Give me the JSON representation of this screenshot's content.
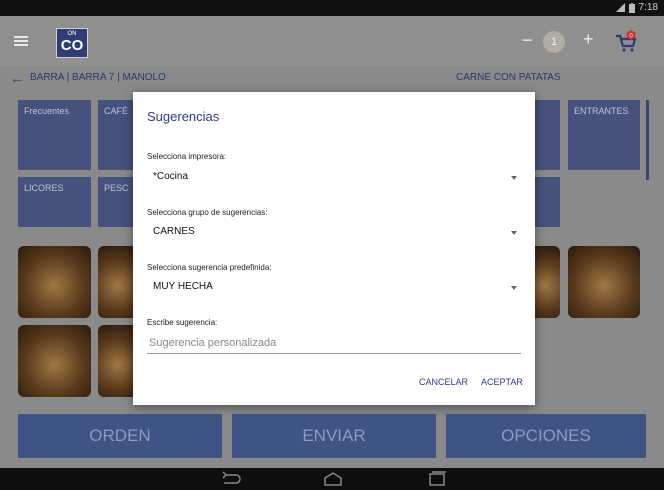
{
  "status_bar": {
    "time": "7:18"
  },
  "app_bar": {
    "logo_top": "ON",
    "logo_main": "CO",
    "qty_minus": "−",
    "qty_value": "1",
    "qty_plus": "+",
    "cart_badge": "0"
  },
  "breadcrumb": {
    "path": "BARRA | BARRA 7 | MANOLO",
    "dish": "CARNE CON PATATAS"
  },
  "categories": [
    {
      "label": "Frecuentes"
    },
    {
      "label": "CAFÉ"
    },
    {
      "label": "ENTRANTES"
    },
    {
      "label": "LICORES"
    },
    {
      "label": "PESC"
    }
  ],
  "bottom_buttons": {
    "orden": "ORDEN",
    "enviar": "ENVIAR",
    "opciones": "OPCIONES"
  },
  "dialog": {
    "title": "Sugerencias",
    "printer_label": "Selecciona impresora:",
    "printer_value": "*Cocina",
    "group_label": "Selecciona grupo de sugerencias:",
    "group_value": "CARNES",
    "preset_label": "Selecciona sugerencia predefinida:",
    "preset_value": "MUY HECHA",
    "custom_label": "Escribe sugerencia:",
    "custom_placeholder": "Sugerencia personalizada",
    "custom_value": "",
    "cancel_label": "CANCELAR",
    "accept_label": "ACEPTAR"
  },
  "colors": {
    "accent": "#2e3a8c",
    "tile": "#46517d",
    "bottom_button": "#3f5385"
  }
}
